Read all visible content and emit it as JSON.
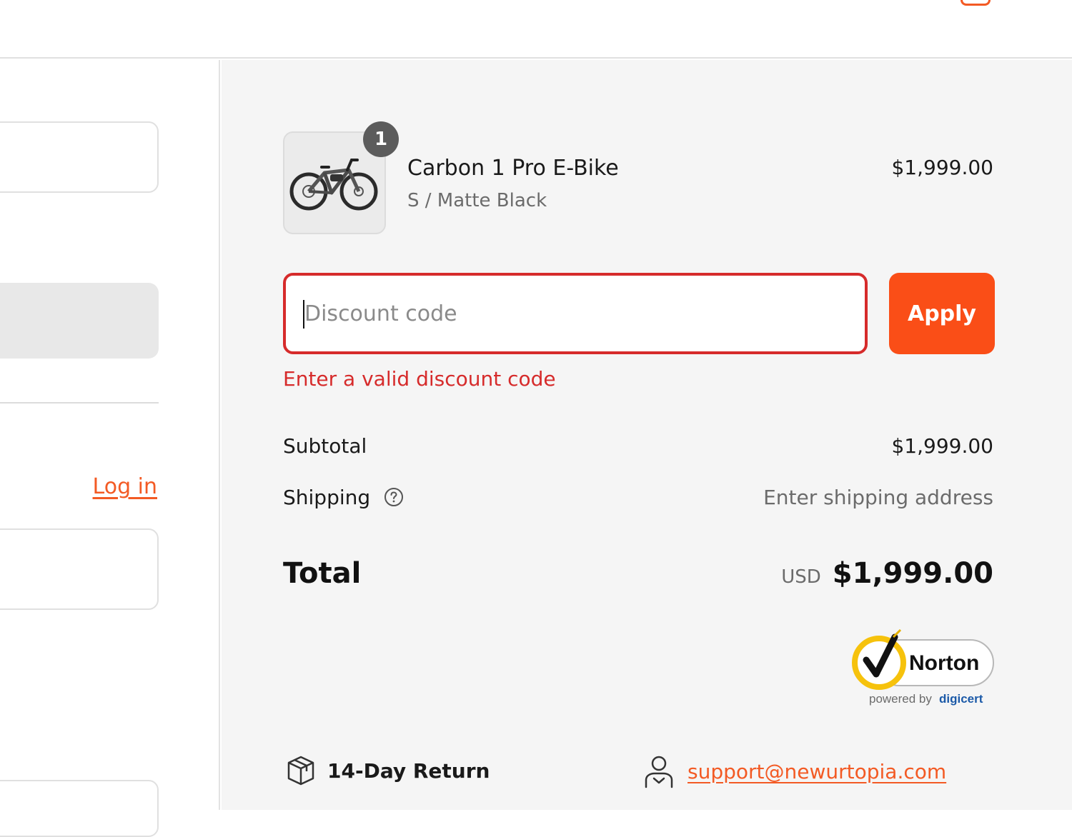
{
  "header": {
    "cart_icon": "cart-icon"
  },
  "left": {
    "login_link": "Log in"
  },
  "order": {
    "item": {
      "quantity": "1",
      "name": "Carbon 1 Pro E-Bike",
      "variant": "S / Matte Black",
      "price": "$1,999.00",
      "image_icon": "bike-icon"
    },
    "discount": {
      "placeholder": "Discount code",
      "value": "",
      "apply_label": "Apply",
      "error": "Enter a valid discount code",
      "error_color": "#d62b2b"
    },
    "subtotal": {
      "label": "Subtotal",
      "value": "$1,999.00"
    },
    "shipping": {
      "label": "Shipping",
      "value": "Enter shipping address",
      "help_icon": "question-circle-icon"
    },
    "total": {
      "label": "Total",
      "currency": "USD",
      "value": "$1,999.00"
    },
    "badge": {
      "brand": "Norton",
      "powered_by": "powered by",
      "partner": "digicert"
    },
    "footer": {
      "return_text": "14-Day Return",
      "return_icon": "box-icon",
      "support_email": "support@newurtopia.com",
      "support_icon": "support-agent-icon"
    }
  },
  "colors": {
    "accent": "#fa4e17",
    "link": "#f35a24",
    "panel_bg": "#f5f5f5",
    "error": "#d62b2b"
  }
}
